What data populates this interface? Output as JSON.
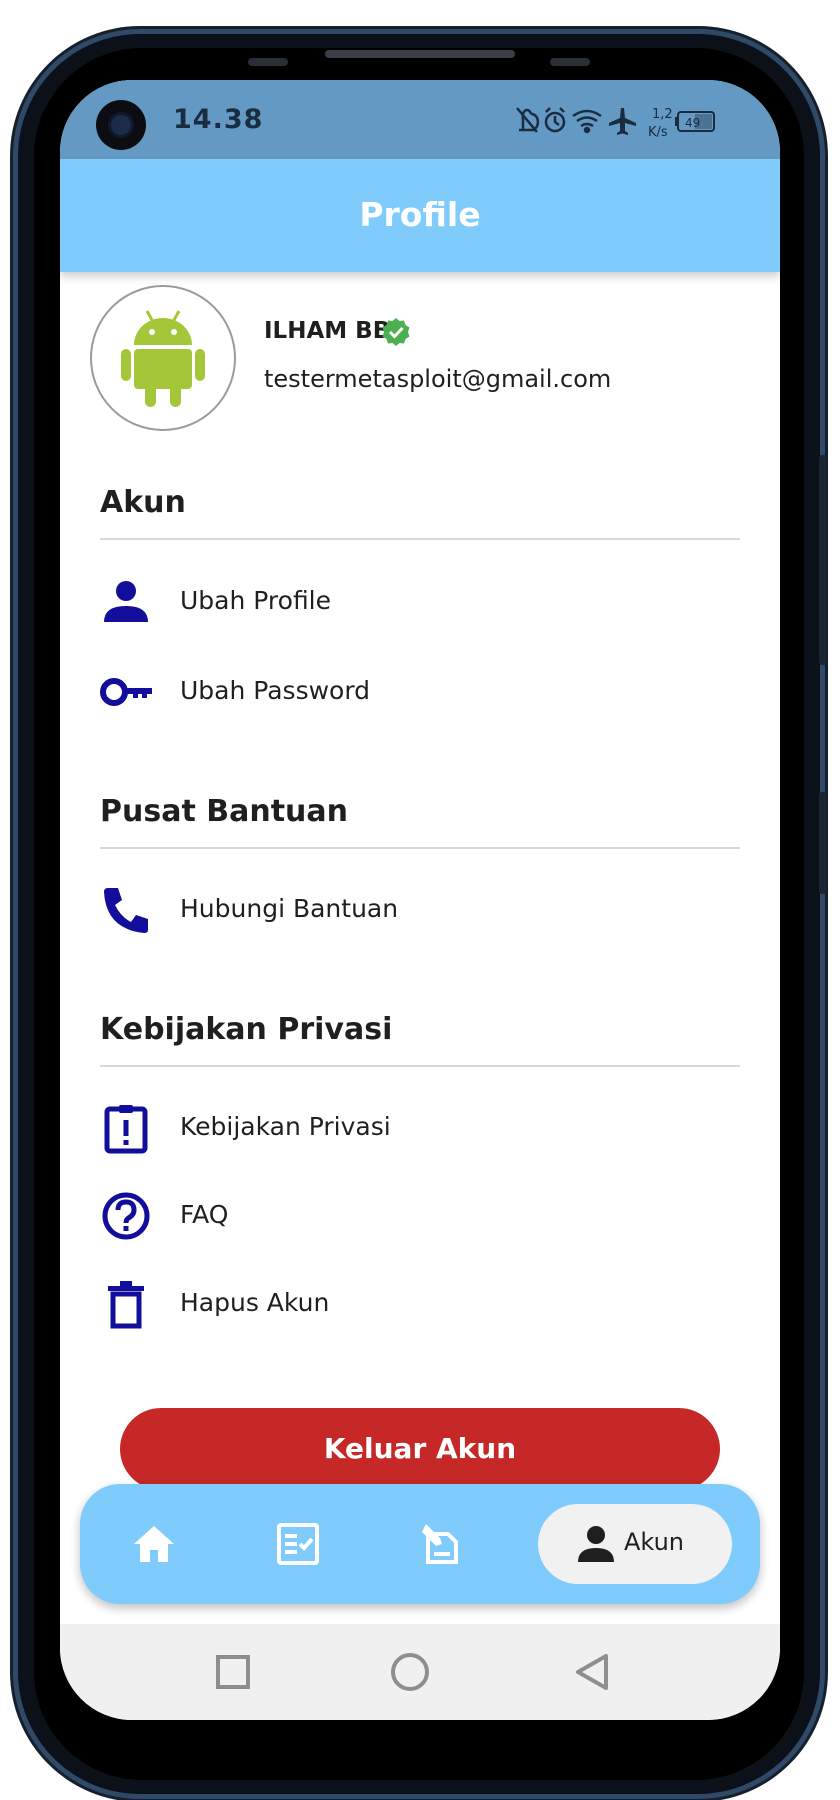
{
  "status_bar": {
    "time": "14.38",
    "network_speed_line1": "1,2",
    "network_speed_line2": "K/s",
    "battery": "49",
    "icons": [
      "mute-bell-icon",
      "alarm-icon",
      "wifi-icon",
      "airplane-icon",
      "battery-icon"
    ]
  },
  "app_bar": {
    "title": "Profile"
  },
  "profile": {
    "name": "ILHAM BB",
    "email": "testermetasploit@gmail.com",
    "avatar_icon": "android-icon",
    "verified_icon": "verified-badge-icon"
  },
  "sections": [
    {
      "title": "Akun",
      "items": [
        {
          "label": "Ubah Profile",
          "icon": "person-icon"
        },
        {
          "label": "Ubah Password",
          "icon": "key-icon"
        }
      ]
    },
    {
      "title": "Pusat Bantuan",
      "items": [
        {
          "label": "Hubungi Bantuan",
          "icon": "phone-icon"
        }
      ]
    },
    {
      "title": "Kebijakan Privasi",
      "items": [
        {
          "label": "Kebijakan Privasi",
          "icon": "policy-clipboard-icon"
        },
        {
          "label": "FAQ",
          "icon": "help-circle-icon"
        },
        {
          "label": "Hapus Akun",
          "icon": "trash-icon"
        }
      ]
    }
  ],
  "logout_button": {
    "label": "Keluar Akun"
  },
  "bottom_nav": {
    "items": [
      {
        "icon": "home-icon"
      },
      {
        "icon": "checklist-icon"
      },
      {
        "icon": "edit-document-icon"
      },
      {
        "icon": "person-icon",
        "label": "Akun",
        "selected": true
      }
    ]
  },
  "system_nav": {
    "icons": [
      "recents-square-icon",
      "home-circle-icon",
      "back-triangle-icon"
    ]
  },
  "colors": {
    "status_bar": "#6399c2",
    "app_bar": "#7ecbfc",
    "accent_icon": "#120d9a",
    "logout": "#c62828",
    "verified": "#4caf50",
    "android": "#a4c639"
  }
}
